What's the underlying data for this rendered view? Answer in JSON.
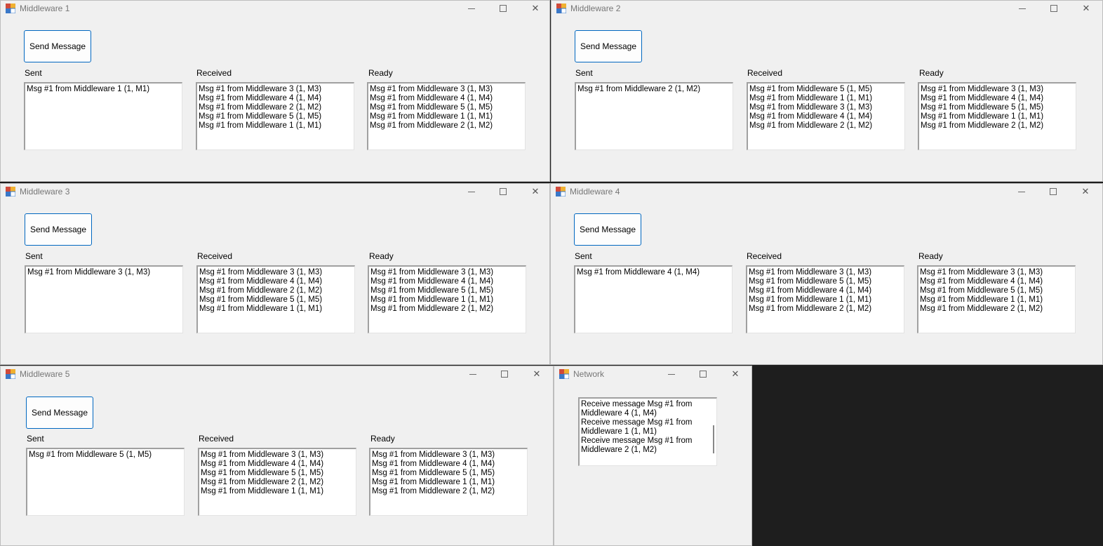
{
  "windows": [
    {
      "title": "Middleware 1",
      "send_label": "Send Message",
      "sent_label": "Sent",
      "received_label": "Received",
      "ready_label": "Ready",
      "sent": [
        "Msg #1 from Middleware 1 (1, M1)"
      ],
      "received": [
        "Msg #1 from Middleware 3 (1, M3)",
        "Msg #1 from Middleware 4 (1, M4)",
        "Msg #1 from Middleware 2 (1, M2)",
        "Msg #1 from Middleware 5 (1, M5)",
        "Msg #1 from Middleware 1 (1, M1)"
      ],
      "ready": [
        "Msg #1 from Middleware 3 (1, M3)",
        "Msg #1 from Middleware 4 (1, M4)",
        "Msg #1 from Middleware 5 (1, M5)",
        "Msg #1 from Middleware 1 (1, M1)",
        "Msg #1 from Middleware 2 (1, M2)"
      ]
    },
    {
      "title": "Middleware 2",
      "send_label": "Send Message",
      "sent_label": "Sent",
      "received_label": "Received",
      "ready_label": "Ready",
      "sent": [
        "Msg #1 from Middleware 2 (1, M2)"
      ],
      "received": [
        "Msg #1 from Middleware 5 (1, M5)",
        "Msg #1 from Middleware 1 (1, M1)",
        "Msg #1 from Middleware 3 (1, M3)",
        "Msg #1 from Middleware 4 (1, M4)",
        "Msg #1 from Middleware 2 (1, M2)"
      ],
      "ready": [
        "Msg #1 from Middleware 3 (1, M3)",
        "Msg #1 from Middleware 4 (1, M4)",
        "Msg #1 from Middleware 5 (1, M5)",
        "Msg #1 from Middleware 1 (1, M1)",
        "Msg #1 from Middleware 2 (1, M2)"
      ]
    },
    {
      "title": "Middleware 3",
      "send_label": "Send Message",
      "sent_label": "Sent",
      "received_label": "Received",
      "ready_label": "Ready",
      "sent": [
        "Msg #1 from Middleware 3 (1, M3)"
      ],
      "received": [
        "Msg #1 from Middleware 3 (1, M3)",
        "Msg #1 from Middleware 4 (1, M4)",
        "Msg #1 from Middleware 2 (1, M2)",
        "Msg #1 from Middleware 5 (1, M5)",
        "Msg #1 from Middleware 1 (1, M1)"
      ],
      "ready": [
        "Msg #1 from Middleware 3 (1, M3)",
        "Msg #1 from Middleware 4 (1, M4)",
        "Msg #1 from Middleware 5 (1, M5)",
        "Msg #1 from Middleware 1 (1, M1)",
        "Msg #1 from Middleware 2 (1, M2)"
      ]
    },
    {
      "title": "Middleware 4",
      "send_label": "Send Message",
      "sent_label": "Sent",
      "received_label": "Received",
      "ready_label": "Ready",
      "sent": [
        "Msg #1 from Middleware 4 (1, M4)"
      ],
      "received": [
        "Msg #1 from Middleware 3 (1, M3)",
        "Msg #1 from Middleware 5 (1, M5)",
        "Msg #1 from Middleware 4 (1, M4)",
        "Msg #1 from Middleware 1 (1, M1)",
        "Msg #1 from Middleware 2 (1, M2)"
      ],
      "ready": [
        "Msg #1 from Middleware 3 (1, M3)",
        "Msg #1 from Middleware 4 (1, M4)",
        "Msg #1 from Middleware 5 (1, M5)",
        "Msg #1 from Middleware 1 (1, M1)",
        "Msg #1 from Middleware 2 (1, M2)"
      ]
    },
    {
      "title": "Middleware 5",
      "send_label": "Send Message",
      "sent_label": "Sent",
      "received_label": "Received",
      "ready_label": "Ready",
      "sent": [
        "Msg #1 from Middleware 5 (1, M5)"
      ],
      "received": [
        "Msg #1 from Middleware 3 (1, M3)",
        "Msg #1 from Middleware 4 (1, M4)",
        "Msg #1 from Middleware 5 (1, M5)",
        "Msg #1 from Middleware 2 (1, M2)",
        "Msg #1 from Middleware 1 (1, M1)"
      ],
      "ready": [
        "Msg #1 from Middleware 3 (1, M3)",
        "Msg #1 from Middleware 4 (1, M4)",
        "Msg #1 from Middleware 5 (1, M5)",
        "Msg #1 from Middleware 1 (1, M1)",
        "Msg #1 from Middleware 2 (1, M2)"
      ]
    }
  ],
  "network": {
    "title": "Network",
    "log": [
      "Receive message Msg #1 from Middleware 4 (1, M4)",
      "Receive message Msg #1 from Middleware 1 (1, M1)",
      "Receive message Msg #1 from Middleware 2 (1, M2)"
    ]
  },
  "icons": {
    "app": "app-icon",
    "minimize": "minimize-icon",
    "maximize": "maximize-icon",
    "close": "close-icon"
  },
  "colors": {
    "desktop": "#1e1e1e",
    "window": "#f0f0f0",
    "button_border": "#0067c0"
  }
}
